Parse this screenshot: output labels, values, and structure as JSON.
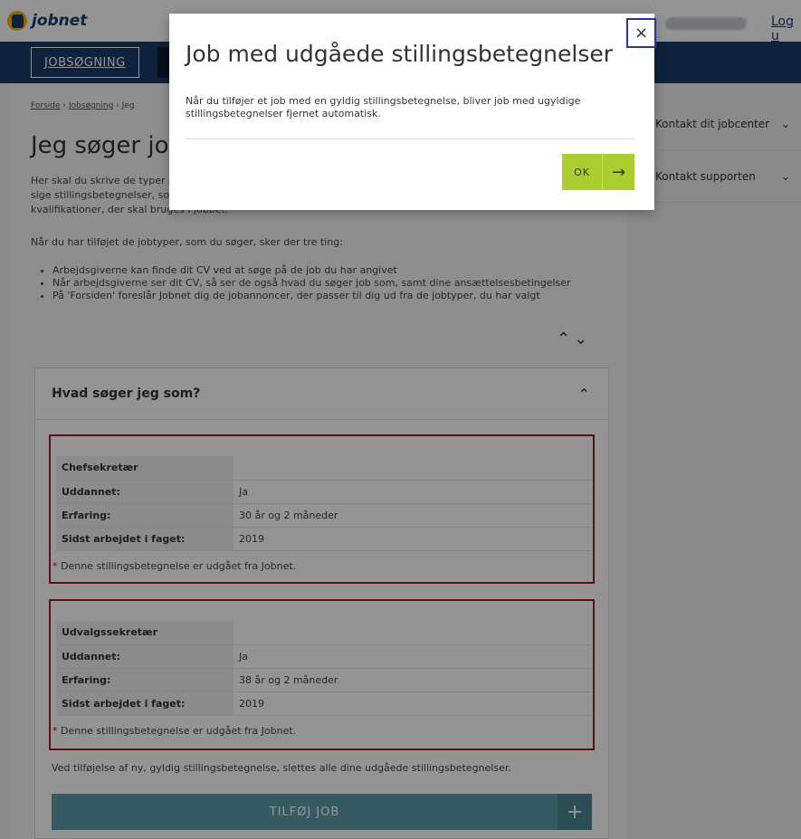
{
  "header": {
    "logo_text": "jobnet",
    "logout_label": "Log u"
  },
  "nav": {
    "tab_label": "JOBSØGNING"
  },
  "breadcrumb": {
    "items": [
      "Forside",
      "Jobsøgning",
      "Jeg"
    ],
    "separator": "›"
  },
  "page": {
    "title": "Jeg søger job",
    "intro": "Her skal du skrive de typer af job, du søger. Det er vigtigt, at du skriver de arbejdsopgaver, du kan varetage - det vil sige stillingsbetegnelser, som du kan anvende dine kompetencer i. Det er også på samme måde de faglige kvalifikationer, der skal bruges i jobbet.",
    "para2": "Når du har tilføjet de jobtyper, som du søger, sker der tre ting:",
    "bullets": [
      "Arbejdsgiverne kan finde dit CV ved at søge på de job du har angivet",
      "Når arbejdsgiverne ser dit CV, så ser de også hvad du søger job som, samt dine ansættelsesbetingelser",
      "På 'Forsiden' foreslår Jobnet dig de jobannoncer, der passer til dig ud fra de jobtyper, du har valgt"
    ],
    "expand_icon": "⌃⌄"
  },
  "sidebar": {
    "items": [
      {
        "label": "Kontakt dit jobcenter",
        "icon": "⌄"
      },
      {
        "label": "Kontakt supporten",
        "icon": "⌄"
      }
    ]
  },
  "panel": {
    "title": "Hvad søger jeg som?",
    "caret": "⌃",
    "jobs": [
      {
        "title": "Chefsekretær",
        "rows": [
          {
            "key": "Uddannet:",
            "value": "Ja"
          },
          {
            "key": "Erfaring:",
            "value": "30 år og 2 måneder"
          },
          {
            "key": "Sidst arbejdet i faget:",
            "value": "2019"
          }
        ],
        "note_star": "*",
        "note": " Denne stillingsbetegnelse er udgået fra Jobnet."
      },
      {
        "title": "Udvalgssekretær",
        "rows": [
          {
            "key": "Uddannet:",
            "value": "Ja"
          },
          {
            "key": "Erfaring:",
            "value": "38 år og 2 måneder"
          },
          {
            "key": "Sidst arbejdet i faget:",
            "value": "2019"
          }
        ],
        "note_star": "*",
        "note": " Denne stillingsbetegnelse er udgået fra Jobnet."
      }
    ],
    "bottom_note": "Ved tilføjelse af ny, gyldig stillingsbetegnelse, slettes alle dine udgåede stillingsbetegnelser.",
    "add_button": "TILFØJ JOB",
    "add_icon": "+"
  },
  "modal": {
    "title": "Job med udgåede stillingsbetegnelser",
    "text": "Når du tilføjer et job med en gyldig stillingsbetegnelse, bliver job med ugyldige stillingsbetegnelser fjernet automatisk.",
    "ok_label": "OK",
    "ok_icon": "→",
    "close_icon": "×"
  }
}
